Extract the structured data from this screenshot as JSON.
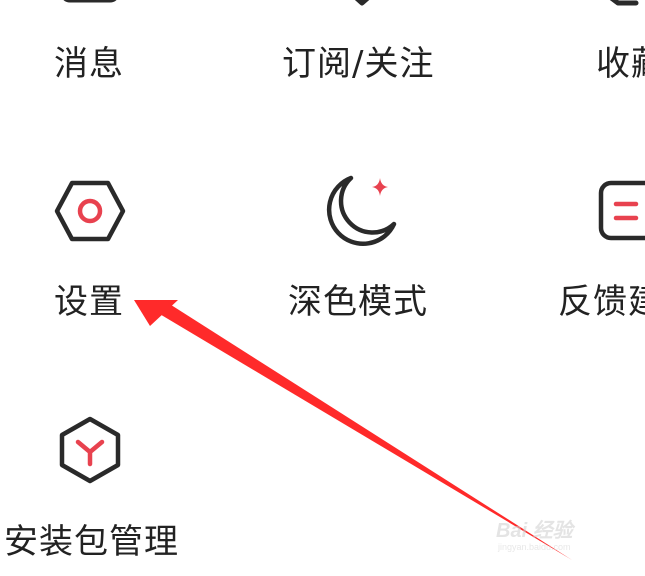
{
  "menu": {
    "row1": [
      {
        "label": "消息",
        "icon": "message-icon"
      },
      {
        "label": "订阅/关注",
        "icon": "subscribe-icon"
      },
      {
        "label": "收藏",
        "icon": "favorite-icon"
      }
    ],
    "row2": [
      {
        "label": "设置",
        "icon": "settings-hexagon-icon"
      },
      {
        "label": "深色模式",
        "icon": "moon-sparkle-icon"
      },
      {
        "label": "反馈建议",
        "icon": "feedback-icon"
      }
    ],
    "row3": [
      {
        "label": "安装包管理",
        "icon": "package-cube-icon"
      }
    ]
  },
  "annotation": {
    "arrow_color": "#ff2a2a",
    "points_to": "设置"
  },
  "watermark": {
    "text": "Bai 经验",
    "url": "jingyan.baidu.com"
  },
  "colors": {
    "icon_stroke": "#2a2a2a",
    "accent": "#e8424f",
    "text": "#222222",
    "background": "#ffffff"
  }
}
